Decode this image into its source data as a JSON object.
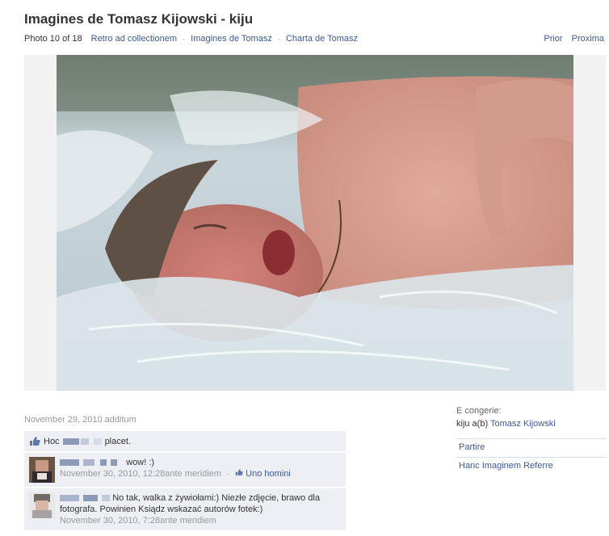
{
  "header": {
    "title": "Imagines de Tomasz Kijowski - kiju",
    "photo_count": "Photo 10 of 18",
    "links": [
      "Retro ad collectionem",
      "Imagines de Tomasz",
      "Charta de Tomasz"
    ],
    "separator": "·",
    "prev": "Prior",
    "next": "Proxima"
  },
  "photo": {
    "alt": ""
  },
  "meta": {
    "added": "November 29, 2010 additum"
  },
  "album": {
    "label": "E congerie:",
    "owner_prefix": "kiju a(b)",
    "owner_name": "Tomasz Kijowski",
    "share": "Partire",
    "report": "Hanc Imaginem Referre"
  },
  "likes": {
    "prefix": "Hoc",
    "suffix": "placet."
  },
  "comments": [
    {
      "text": "wow! :)",
      "time": "November 30, 2010, 12:28ante meridiem",
      "separator": "·",
      "like_count": "Uno homini"
    },
    {
      "text": "No tak, walka z żywiołami:) Niezłe zdjęcie, brawo dla fotografa. Powinien Ksiądz wskazać autorów fotek:)",
      "time": "November 30, 2010, 7:28ante meridiem"
    }
  ],
  "colors": {
    "link": "#3b5998",
    "ufi_bg": "#edeff4",
    "muted": "#999999"
  },
  "icons": {
    "like": "thumbs-up-icon"
  }
}
